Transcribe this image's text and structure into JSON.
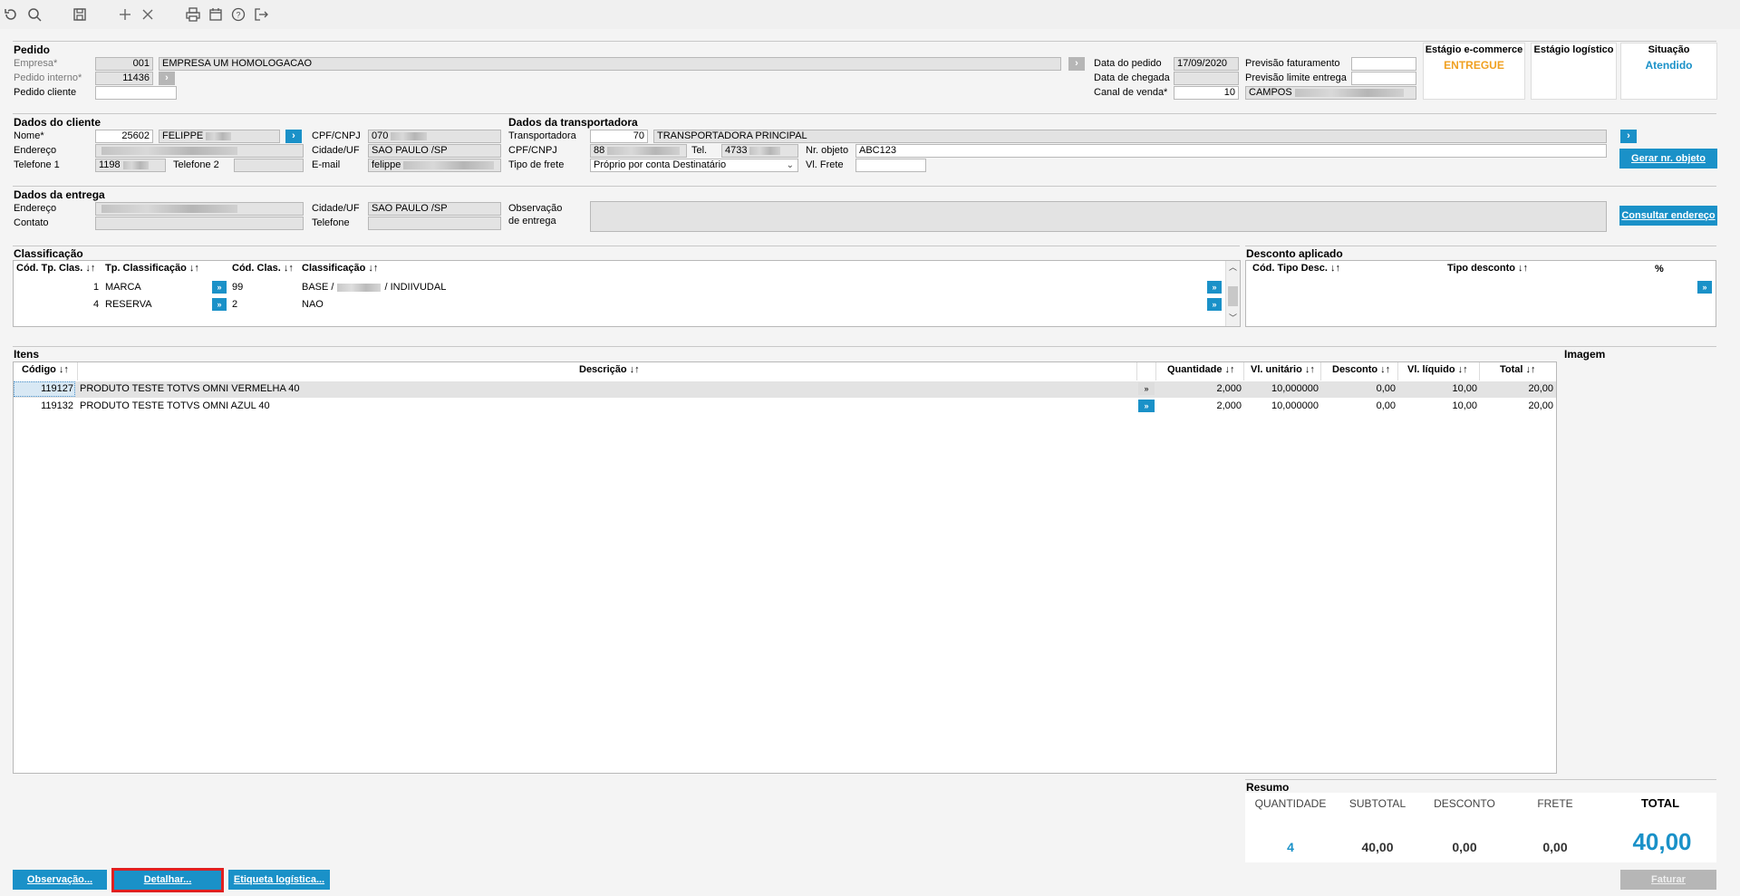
{
  "toolbar": {
    "icons": [
      "refresh-icon",
      "search-icon",
      "save-icon",
      "add-icon",
      "close-icon",
      "print-icon",
      "calendar-icon",
      "help-icon",
      "exit-icon"
    ]
  },
  "pedido": {
    "title": "Pedido",
    "empresa_label": "Empresa*",
    "empresa_code": "001",
    "empresa_name": "EMPRESA UM HOMOLOGACAO",
    "pedido_interno_label": "Pedido interno*",
    "pedido_interno": "11436",
    "pedido_cliente_label": "Pedido cliente",
    "pedido_cliente": "",
    "data_pedido_label": "Data do pedido",
    "data_pedido": "17/09/2020",
    "data_chegada_label": "Data de chegada",
    "data_chegada": "",
    "canal_label": "Canal de venda*",
    "canal": "10",
    "prev_fat_label": "Previsão faturamento",
    "prev_fat": "",
    "prev_lim_label": "Previsão limite entrega",
    "prev_lim": "",
    "campos": "CAMPOS"
  },
  "stages": {
    "ecommerce_title": "Estágio e-commerce",
    "ecommerce_value": "ENTREGUE",
    "ecommerce_color": "#f0a020",
    "logistico_title": "Estágio logístico",
    "logistico_value": "",
    "situacao_title": "Situação",
    "situacao_value": "Atendido",
    "situacao_color": "#1a91c8"
  },
  "cliente": {
    "title": "Dados do cliente",
    "nome_label": "Nome*",
    "nome_code": "25602",
    "nome": "FELIPPE",
    "endereco_label": "Endereço",
    "telefone1_label": "Telefone 1",
    "telefone1": "1198",
    "telefone2_label": "Telefone 2",
    "cpf_label": "CPF/CNPJ",
    "cpf": "070",
    "cidade_label": "Cidade/UF",
    "cidade": "SAO PAULO /SP",
    "email_label": "E-mail",
    "email": "felippe"
  },
  "transportadora": {
    "title": "Dados da transportadora",
    "transp_label": "Transportadora",
    "transp_code": "70",
    "transp_name": "TRANSPORTADORA PRINCIPAL",
    "cpf_label": "CPF/CNPJ",
    "cpf": "88",
    "tel_label": "Tel.",
    "tel": "4733",
    "nr_objeto_label": "Nr. objeto",
    "nr_objeto": "ABC123",
    "tipo_frete_label": "Tipo de frete",
    "tipo_frete": "Próprio por conta Destinatário",
    "vl_frete_label": "Vl. Frete",
    "vl_frete": "",
    "gerar_button": "Gerar nr. objeto"
  },
  "entrega": {
    "title": "Dados da entrega",
    "endereco_label": "Endereço",
    "contato_label": "Contato",
    "cidade_label": "Cidade/UF",
    "cidade": "SAO PAULO /SP",
    "telefone_label": "Telefone",
    "observacao_label_1": "Observação",
    "observacao_label_2": "de entrega",
    "consultar_button": "Consultar endereço"
  },
  "classificacao": {
    "title": "Classificação",
    "headers": [
      "Cód. Tp. Clas. ↓↑",
      "Tp. Classificação ↓↑",
      "Cód. Clas. ↓↑",
      "Classificação ↓↑"
    ],
    "rows": [
      {
        "cod_tp": "1",
        "tp": "MARCA",
        "cod": "99",
        "clas_a": "BASE /",
        "clas_b": "/ INDIIVUDAL"
      },
      {
        "cod_tp": "4",
        "tp": "RESERVA",
        "cod": "2",
        "clas_a": "NAO",
        "clas_b": ""
      }
    ]
  },
  "desconto": {
    "title": "Desconto aplicado",
    "headers": [
      "Cód. Tipo Desc. ↓↑",
      "Tipo desconto ↓↑",
      "%"
    ]
  },
  "itens": {
    "title": "Itens",
    "imagem_label": "Imagem",
    "headers": [
      "Código ↓↑",
      "Descrição ↓↑",
      "Quantidade ↓↑",
      "Vl. unitário ↓↑",
      "Desconto ↓↑",
      "Vl. líquido ↓↑",
      "Total ↓↑"
    ],
    "rows": [
      {
        "codigo": "119127",
        "descricao": "PRODUTO TESTE TOTVS OMNI VERMELHA 40",
        "qtd": "2,000",
        "unit": "10,000000",
        "desc": "0,00",
        "liq": "10,00",
        "total": "20,00"
      },
      {
        "codigo": "119132",
        "descricao": "PRODUTO TESTE TOTVS OMNI AZUL 40",
        "qtd": "2,000",
        "unit": "10,000000",
        "desc": "0,00",
        "liq": "10,00",
        "total": "20,00"
      }
    ]
  },
  "resumo": {
    "title": "Resumo",
    "quantidade_label": "QUANTIDADE",
    "quantidade": "4",
    "subtotal_label": "SUBTOTAL",
    "subtotal": "40,00",
    "desconto_label": "DESCONTO",
    "desconto": "0,00",
    "frete_label": "FRETE",
    "frete": "0,00",
    "total_label": "TOTAL",
    "total": "40,00"
  },
  "footer": {
    "observacao_button": "Observação...",
    "detalhar_button": "Detalhar...",
    "etiqueta_button": "Etiqueta logística...",
    "faturar_button": "Faturar"
  },
  "colors": {
    "accent": "#1a91c8",
    "highlight_border": "#e02020"
  }
}
